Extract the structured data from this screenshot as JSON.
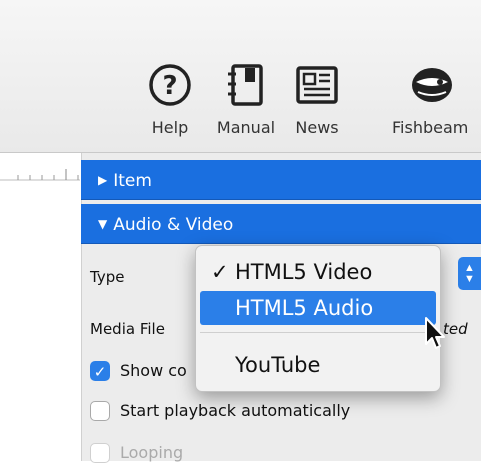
{
  "toolbar": {
    "items": [
      {
        "label": "Help",
        "icon": "question-circle-icon"
      },
      {
        "label": "Manual",
        "icon": "book-icon"
      },
      {
        "label": "News",
        "icon": "newspaper-icon"
      },
      {
        "label": "Fishbeam",
        "icon": "fish-icon"
      }
    ]
  },
  "inspector": {
    "sections": [
      {
        "title": "Item",
        "expanded": false
      },
      {
        "title": "Audio & Video",
        "expanded": true
      }
    ],
    "type_label": "Type",
    "media_file_label": "Media File",
    "media_file_value_partial": "ted",
    "checkboxes": [
      {
        "label": "Show co",
        "checked": true
      },
      {
        "label": "Start playback automatically",
        "checked": false
      },
      {
        "label": "Looping",
        "checked": false,
        "disabled": true
      }
    ]
  },
  "type_menu": {
    "items": [
      "HTML5 Video",
      "HTML5 Audio",
      "YouTube"
    ],
    "checked": "HTML5 Video",
    "highlighted": "HTML5 Audio"
  },
  "colors": {
    "section_blue": "#1a6fe0",
    "selection_blue": "#2b7fe8"
  }
}
